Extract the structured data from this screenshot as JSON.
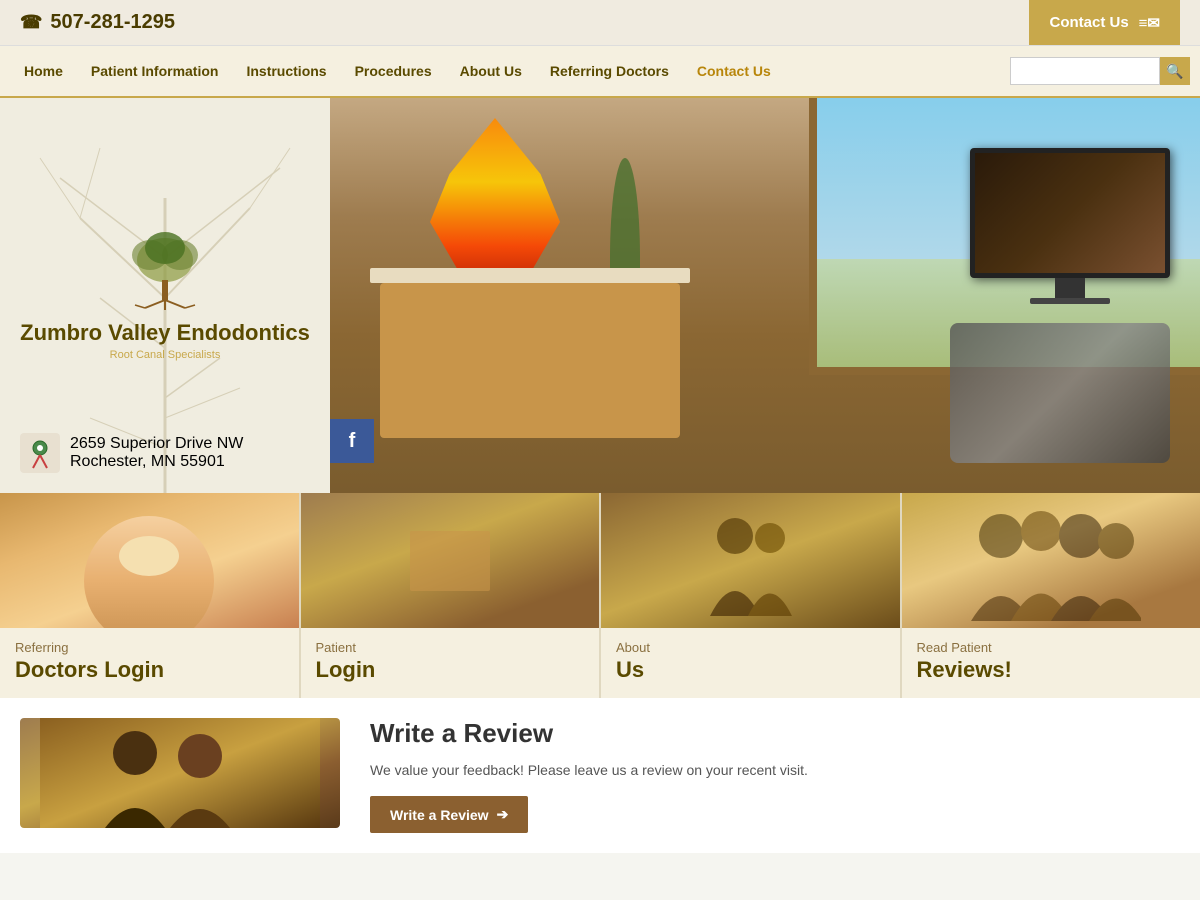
{
  "topbar": {
    "phone": "507-281-1295",
    "contact_label": "Contact Us",
    "phone_icon": "☎",
    "mail_icon": "✉",
    "contact_icon": "≡"
  },
  "nav": {
    "items": [
      {
        "label": "Home",
        "id": "home"
      },
      {
        "label": "Patient Information",
        "id": "patient-information"
      },
      {
        "label": "Instructions",
        "id": "instructions"
      },
      {
        "label": "Procedures",
        "id": "procedures"
      },
      {
        "label": "About Us",
        "id": "about-us"
      },
      {
        "label": "Referring Doctors",
        "id": "referring-doctors"
      },
      {
        "label": "Contact Us",
        "id": "contact-us-nav"
      }
    ],
    "search_placeholder": ""
  },
  "logo": {
    "name": "Zumbro Valley Endodontics",
    "sub": "Root Canal Specialists"
  },
  "address": {
    "line1": "2659 Superior Drive NW",
    "line2": "Rochester, MN 55901"
  },
  "cards": [
    {
      "subtitle": "Referring",
      "title": "Doctors Login",
      "id": "referring-doctors-card"
    },
    {
      "subtitle": "Patient",
      "title": "Login",
      "id": "patient-login-card"
    },
    {
      "subtitle": "About",
      "title": "Us",
      "id": "about-us-card"
    },
    {
      "subtitle": "Read Patient",
      "title": "Reviews!",
      "id": "reviews-card"
    }
  ],
  "review_section": {
    "title": "Write a Review",
    "description": "We value your feedback! Please leave us a review on your recent visit.",
    "button_label": "Write a Review",
    "button_arrow": "➔"
  }
}
